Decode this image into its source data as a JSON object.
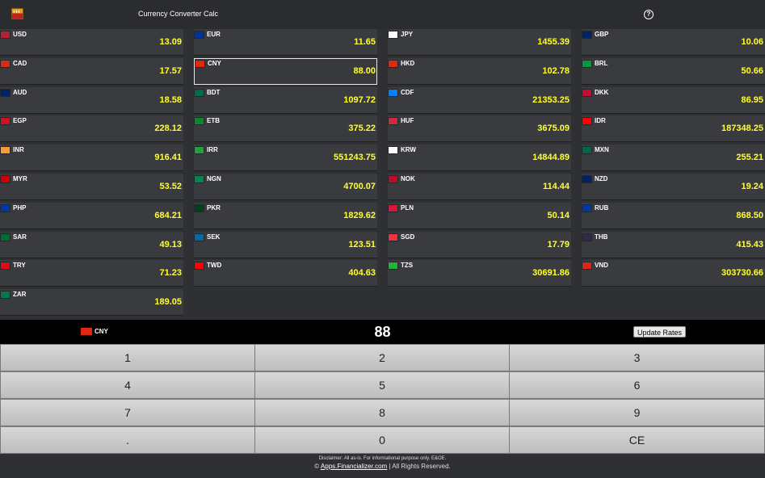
{
  "app": {
    "title": "Currency Converter Calc"
  },
  "currencies": [
    {
      "code": "USD",
      "amount": "13.09",
      "flag": "usd",
      "color": "#b22234"
    },
    {
      "code": "EUR",
      "amount": "11.65",
      "flag": "eur",
      "color": "#003399"
    },
    {
      "code": "JPY",
      "amount": "1455.39",
      "flag": "jpy",
      "color": "#ffffff"
    },
    {
      "code": "GBP",
      "amount": "10.06",
      "flag": "gbp",
      "color": "#012169"
    },
    {
      "code": "CAD",
      "amount": "17.57",
      "flag": "cad",
      "color": "#d52b1e"
    },
    {
      "code": "CNY",
      "amount": "88.00",
      "flag": "cny",
      "color": "#de2910"
    },
    {
      "code": "HKD",
      "amount": "102.78",
      "flag": "hkd",
      "color": "#de2910"
    },
    {
      "code": "BRL",
      "amount": "50.66",
      "flag": "brl",
      "color": "#009c3b"
    },
    {
      "code": "AUD",
      "amount": "18.58",
      "flag": "aud",
      "color": "#012169"
    },
    {
      "code": "BDT",
      "amount": "1097.72",
      "flag": "bdt",
      "color": "#006a4e"
    },
    {
      "code": "CDF",
      "amount": "21353.25",
      "flag": "cdf",
      "color": "#007fff"
    },
    {
      "code": "DKK",
      "amount": "86.95",
      "flag": "dkk",
      "color": "#c60c30"
    },
    {
      "code": "EGP",
      "amount": "228.12",
      "flag": "egp",
      "color": "#ce1126"
    },
    {
      "code": "ETB",
      "amount": "375.22",
      "flag": "etb",
      "color": "#078930"
    },
    {
      "code": "HUF",
      "amount": "3675.09",
      "flag": "huf",
      "color": "#cd2a3e"
    },
    {
      "code": "IDR",
      "amount": "187348.25",
      "flag": "idr",
      "color": "#ff0000"
    },
    {
      "code": "INR",
      "amount": "916.41",
      "flag": "inr",
      "color": "#ff9933"
    },
    {
      "code": "IRR",
      "amount": "551243.75",
      "flag": "irr",
      "color": "#239f40"
    },
    {
      "code": "KRW",
      "amount": "14844.89",
      "flag": "krw",
      "color": "#ffffff"
    },
    {
      "code": "MXN",
      "amount": "255.21",
      "flag": "mxn",
      "color": "#006847"
    },
    {
      "code": "MYR",
      "amount": "53.52",
      "flag": "myr",
      "color": "#cc0001"
    },
    {
      "code": "NGN",
      "amount": "4700.07",
      "flag": "ngn",
      "color": "#008751"
    },
    {
      "code": "NOK",
      "amount": "114.44",
      "flag": "nok",
      "color": "#ba0c2f"
    },
    {
      "code": "NZD",
      "amount": "19.24",
      "flag": "nzd",
      "color": "#012169"
    },
    {
      "code": "PHP",
      "amount": "684.21",
      "flag": "php",
      "color": "#0038a8"
    },
    {
      "code": "PKR",
      "amount": "1829.62",
      "flag": "pkr",
      "color": "#01411c"
    },
    {
      "code": "PLN",
      "amount": "50.14",
      "flag": "pln",
      "color": "#dc143c"
    },
    {
      "code": "RUB",
      "amount": "868.50",
      "flag": "rub",
      "color": "#0039a6"
    },
    {
      "code": "SAR",
      "amount": "49.13",
      "flag": "sar",
      "color": "#006c35"
    },
    {
      "code": "SEK",
      "amount": "123.51",
      "flag": "sek",
      "color": "#006aa7"
    },
    {
      "code": "SGD",
      "amount": "17.79",
      "flag": "sgd",
      "color": "#ef3340"
    },
    {
      "code": "THB",
      "amount": "415.43",
      "flag": "thb",
      "color": "#2d2a4a"
    },
    {
      "code": "TRY",
      "amount": "71.23",
      "flag": "try",
      "color": "#e30a17"
    },
    {
      "code": "TWD",
      "amount": "404.63",
      "flag": "twd",
      "color": "#fe0000"
    },
    {
      "code": "TZS",
      "amount": "30691.86",
      "flag": "tzs",
      "color": "#1eb53a"
    },
    {
      "code": "VND",
      "amount": "303730.66",
      "flag": "vnd",
      "color": "#da251d"
    },
    {
      "code": "ZAR",
      "amount": "189.05",
      "flag": "zar",
      "color": "#007a4d"
    }
  ],
  "selected_currency": "CNY",
  "display": {
    "currency_code": "CNY",
    "value": "88"
  },
  "update_button_label": "Update Rates",
  "keypad": [
    "1",
    "2",
    "3",
    "4",
    "5",
    "6",
    "7",
    "8",
    "9",
    ".",
    "0",
    "CE"
  ],
  "footer": {
    "disclaimer": "Disclaimer: All as-is. For informational purpose only. E&OE.",
    "copyright_prefix": "©",
    "link_text": "Apps.Financializer.com",
    "copyright_suffix": "| All Rights Reserved."
  },
  "icons": {
    "help": "help-circle-icon",
    "logo": "app-logo-icon"
  }
}
